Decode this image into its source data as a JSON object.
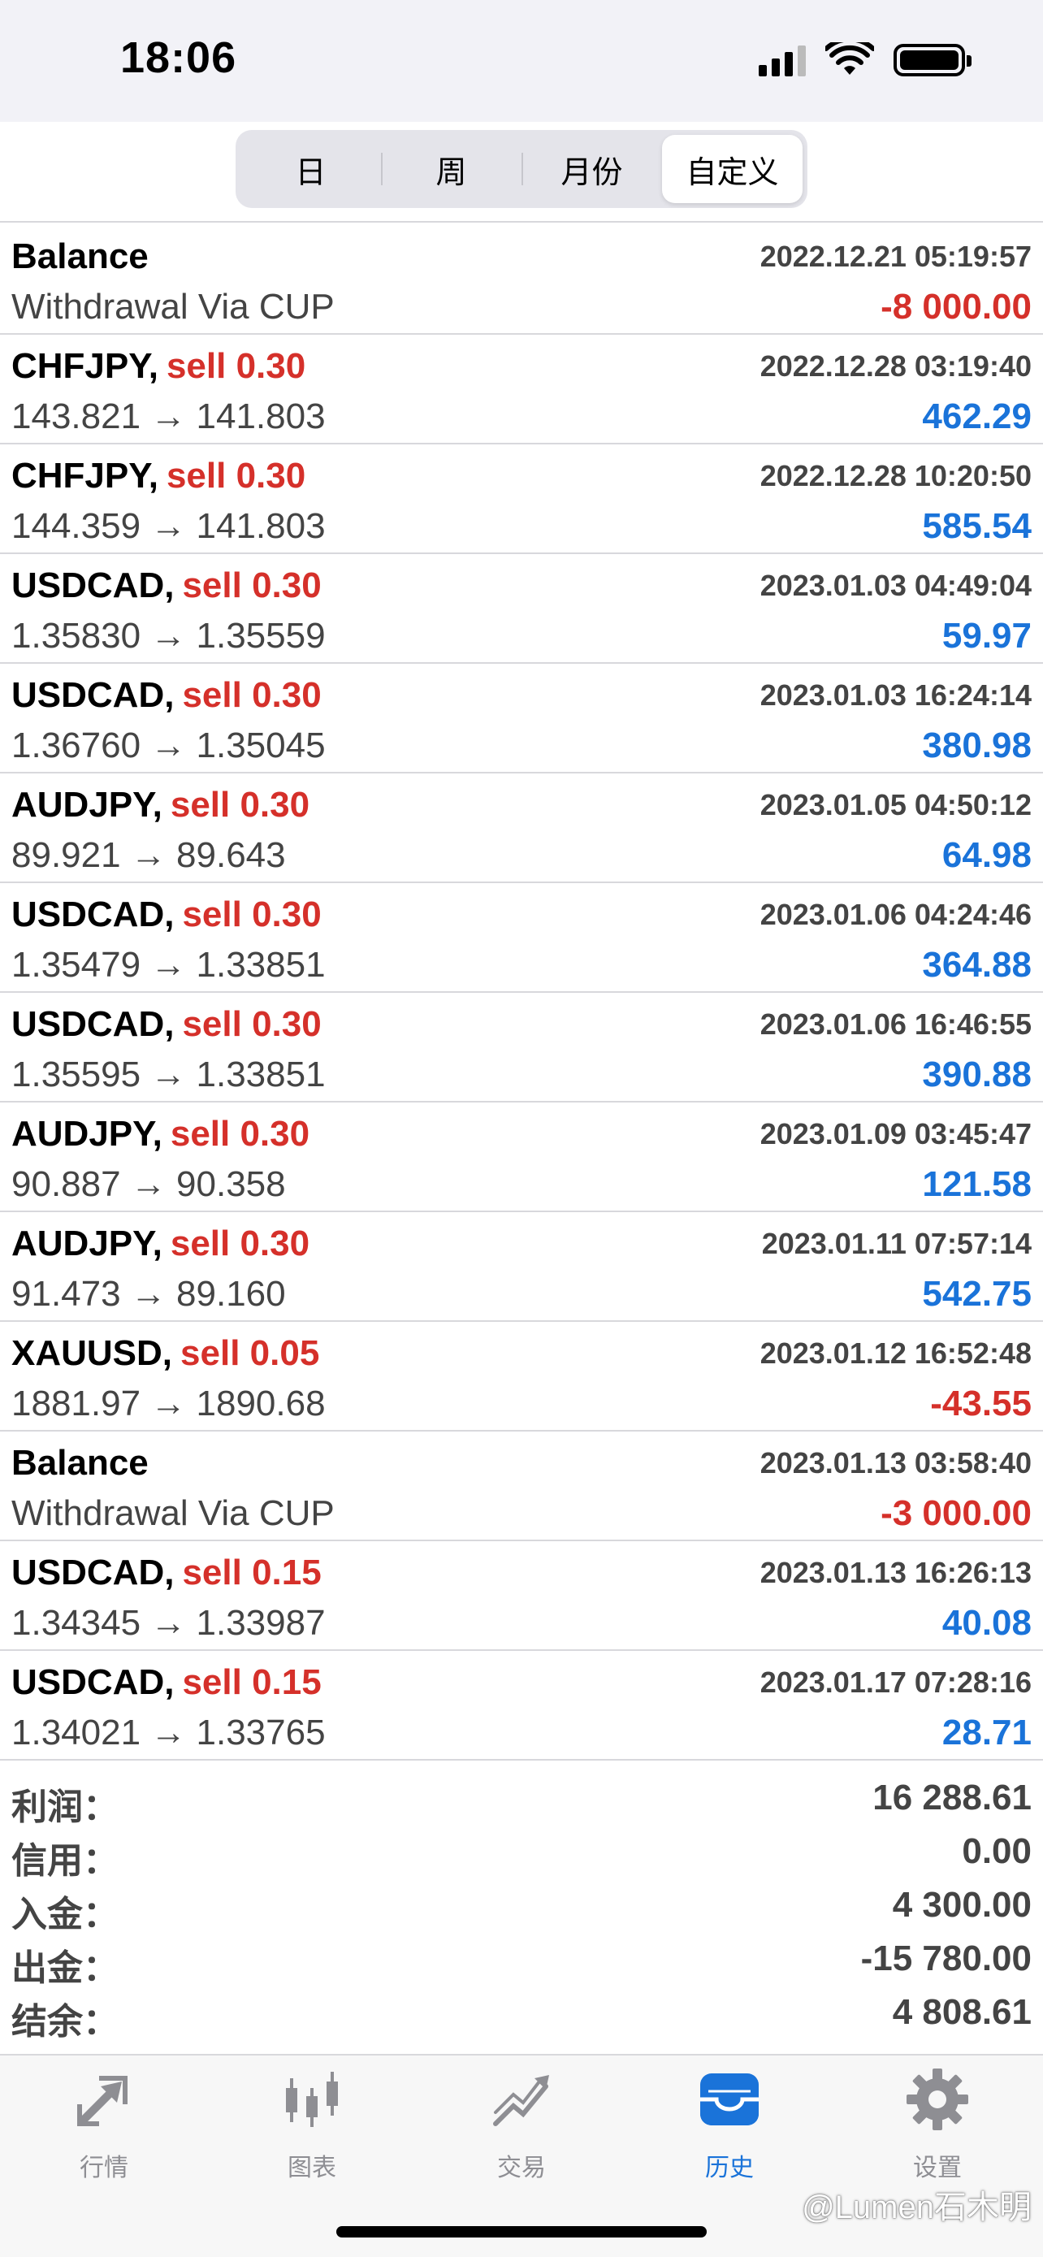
{
  "status_bar": {
    "time": "18:06"
  },
  "period_tabs": [
    {
      "label": "日",
      "active": false
    },
    {
      "label": "周",
      "active": false
    },
    {
      "label": "月份",
      "active": false
    },
    {
      "label": "自定义",
      "active": true
    }
  ],
  "rows": [
    {
      "symbol": "Balance",
      "side": "",
      "date": "2022.12.21 05:19:57",
      "detail": "Withdrawal Via CUP",
      "amount": "-8 000.00",
      "sign": "neg"
    },
    {
      "symbol": "CHFJPY,",
      "side": "sell 0.30",
      "date": "2022.12.28 03:19:40",
      "detail": "143.821 → 141.803",
      "amount": "462.29",
      "sign": "pos"
    },
    {
      "symbol": "CHFJPY,",
      "side": "sell 0.30",
      "date": "2022.12.28 10:20:50",
      "detail": "144.359 → 141.803",
      "amount": "585.54",
      "sign": "pos"
    },
    {
      "symbol": "USDCAD,",
      "side": "sell 0.30",
      "date": "2023.01.03 04:49:04",
      "detail": "1.35830 → 1.35559",
      "amount": "59.97",
      "sign": "pos"
    },
    {
      "symbol": "USDCAD,",
      "side": "sell 0.30",
      "date": "2023.01.03 16:24:14",
      "detail": "1.36760 → 1.35045",
      "amount": "380.98",
      "sign": "pos"
    },
    {
      "symbol": "AUDJPY,",
      "side": "sell 0.30",
      "date": "2023.01.05 04:50:12",
      "detail": "89.921 → 89.643",
      "amount": "64.98",
      "sign": "pos"
    },
    {
      "symbol": "USDCAD,",
      "side": "sell 0.30",
      "date": "2023.01.06 04:24:46",
      "detail": "1.35479 → 1.33851",
      "amount": "364.88",
      "sign": "pos"
    },
    {
      "symbol": "USDCAD,",
      "side": "sell 0.30",
      "date": "2023.01.06 16:46:55",
      "detail": "1.35595 → 1.33851",
      "amount": "390.88",
      "sign": "pos"
    },
    {
      "symbol": "AUDJPY,",
      "side": "sell 0.30",
      "date": "2023.01.09 03:45:47",
      "detail": "90.887 → 90.358",
      "amount": "121.58",
      "sign": "pos"
    },
    {
      "symbol": "AUDJPY,",
      "side": "sell 0.30",
      "date": "2023.01.11 07:57:14",
      "detail": "91.473 → 89.160",
      "amount": "542.75",
      "sign": "pos"
    },
    {
      "symbol": "XAUUSD,",
      "side": "sell 0.05",
      "date": "2023.01.12 16:52:48",
      "detail": "1881.97 → 1890.68",
      "amount": "-43.55",
      "sign": "neg"
    },
    {
      "symbol": "Balance",
      "side": "",
      "date": "2023.01.13 03:58:40",
      "detail": "Withdrawal Via CUP",
      "amount": "-3 000.00",
      "sign": "neg"
    },
    {
      "symbol": "USDCAD,",
      "side": "sell 0.15",
      "date": "2023.01.13 16:26:13",
      "detail": "1.34345 → 1.33987",
      "amount": "40.08",
      "sign": "pos"
    },
    {
      "symbol": "USDCAD,",
      "side": "sell 0.15",
      "date": "2023.01.17 07:28:16",
      "detail": "1.34021 → 1.33765",
      "amount": "28.71",
      "sign": "pos"
    }
  ],
  "summary": [
    {
      "label": "利润：",
      "value": "16 288.61"
    },
    {
      "label": "信用：",
      "value": "0.00"
    },
    {
      "label": "入金：",
      "value": "4 300.00"
    },
    {
      "label": "出金：",
      "value": "-15 780.00"
    },
    {
      "label": "结余：",
      "value": "4 808.61"
    }
  ],
  "tab_bar": [
    {
      "label": "行情",
      "icon": "quotes-arrows-icon",
      "active": false
    },
    {
      "label": "图表",
      "icon": "candlestick-icon",
      "active": false
    },
    {
      "label": "交易",
      "icon": "trade-trend-icon",
      "active": false
    },
    {
      "label": "历史",
      "icon": "history-inbox-icon",
      "active": true
    },
    {
      "label": "设置",
      "icon": "gear-icon",
      "active": false
    }
  ],
  "watermark": "@Lumen石木明",
  "colors": {
    "negative": "#d5302a",
    "positive": "#1a73d9",
    "accent": "#1a73d9",
    "inactive": "#8e8e93"
  }
}
